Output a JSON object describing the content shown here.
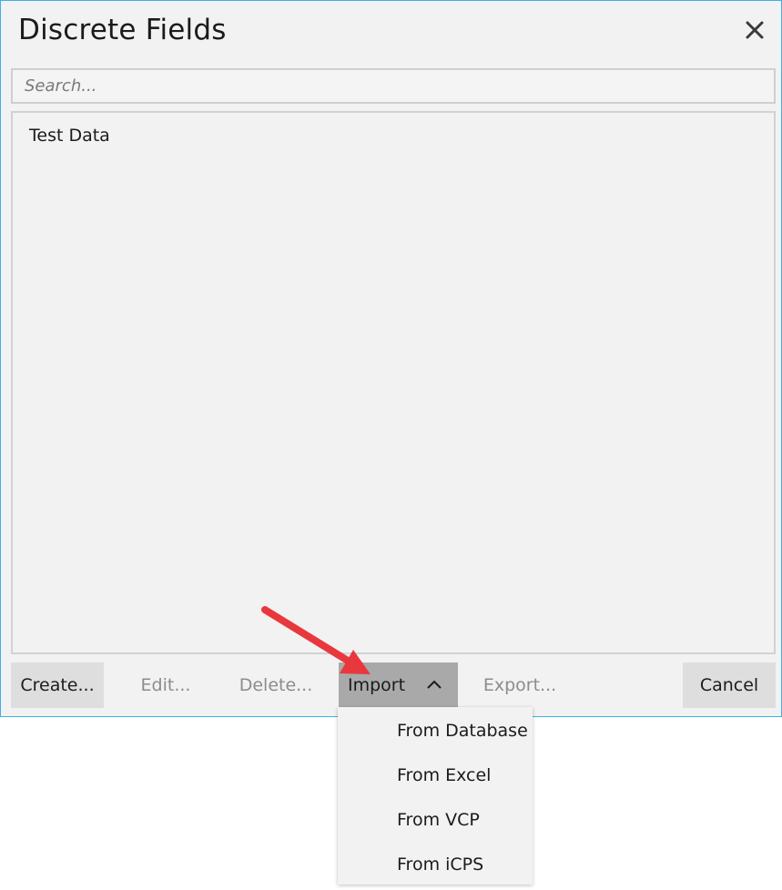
{
  "dialog": {
    "title": "Discrete Fields",
    "close_icon": "close-icon"
  },
  "search": {
    "placeholder": "Search...",
    "value": ""
  },
  "list": {
    "items": [
      "Test Data"
    ]
  },
  "buttons": {
    "create": "Create...",
    "edit": "Edit...",
    "delete": "Delete...",
    "import": "Import",
    "import_icon": "chevron-up-icon",
    "export": "Export...",
    "cancel": "Cancel"
  },
  "import_menu": {
    "items": [
      "From Database",
      "From Excel",
      "From VCP",
      "From iCPS"
    ]
  },
  "annotation": {
    "icon": "red-arrow-icon",
    "color": "#e8383d"
  },
  "colors": {
    "border_accent": "#3fb0e6",
    "import_active_bg": "#a9a9a9",
    "button_bg": "#dedede",
    "disabled_text": "#8c8c8c"
  }
}
